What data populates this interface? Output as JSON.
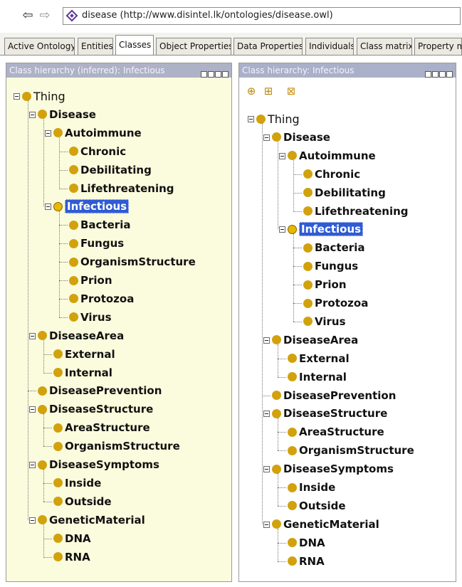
{
  "address": {
    "back_icon": "back-arrow-icon",
    "forward_icon": "forward-arrow-icon",
    "url": "disease (http://www.disintel.lk/ontologies/disease.owl)"
  },
  "tabs": [
    {
      "label": "Active Ontology"
    },
    {
      "label": "Entities"
    },
    {
      "label": "Classes"
    },
    {
      "label": "Object Properties"
    },
    {
      "label": "Data Properties"
    },
    {
      "label": "Individuals"
    },
    {
      "label": "Class matrix"
    },
    {
      "label": "Property m"
    }
  ],
  "active_tab": "Classes",
  "left_panel": {
    "title": "Class hierarchy (inferred): Infectious"
  },
  "right_panel": {
    "title": "Class hierarchy: Infectious",
    "tool_icons": [
      "add-subclass-icon",
      "add-sibling-class-icon",
      "delete-class-icon"
    ]
  },
  "tree_nodes": {
    "thing": "Thing",
    "disease": "Disease",
    "autoimmune": "Autoimmune",
    "chronic": "Chronic",
    "debilitating": "Debilitating",
    "lifethreatening": "Lifethreatening",
    "infectious": "Infectious",
    "bacteria": "Bacteria",
    "fungus": "Fungus",
    "organismstructure": "OrganismStructure",
    "prion": "Prion",
    "protozoa": "Protozoa",
    "virus": "Virus",
    "diseasearea": "DiseaseArea",
    "external": "External",
    "internal": "Internal",
    "diseaseprevention": "DiseasePrevention",
    "diseasestructure": "DiseaseStructure",
    "areastructure": "AreaStructure",
    "diseasesymptoms": "DiseaseSymptoms",
    "inside": "Inside",
    "outside": "Outside",
    "geneticmaterial": "GeneticMaterial",
    "dna": "DNA",
    "rna": "RNA"
  },
  "colors": {
    "class_dot": "#d1a20d",
    "selection": "#2f5bd3",
    "left_panel_bg": "#fbfbdd"
  }
}
